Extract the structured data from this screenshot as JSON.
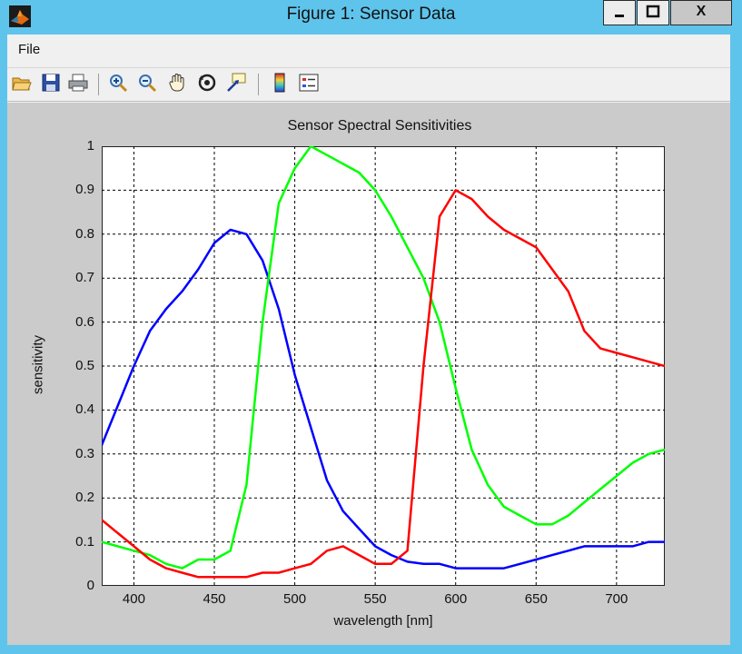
{
  "window": {
    "title": "Figure 1: Sensor Data",
    "close_label": "X"
  },
  "menu": {
    "file": "File"
  },
  "toolbar": {
    "icons": [
      "open-file-icon",
      "save-icon",
      "print-icon",
      "zoom-in-icon",
      "zoom-out-icon",
      "pan-hand-icon",
      "rotate-3d-icon",
      "data-cursor-icon",
      "colorbar-icon",
      "legend-icon"
    ]
  },
  "chart_data": {
    "type": "line",
    "title": "Sensor Spectral Sensitivities",
    "xlabel": "wavelength [nm]",
    "ylabel": "sensitivity",
    "xlim": [
      380,
      730
    ],
    "ylim": [
      0,
      1
    ],
    "grid": true,
    "x_ticks": [
      "400",
      "450",
      "500",
      "550",
      "600",
      "650",
      "700"
    ],
    "y_ticks": [
      "0",
      "0.1",
      "0.2",
      "0.3",
      "0.4",
      "0.5",
      "0.6",
      "0.7",
      "0.8",
      "0.9",
      "1"
    ],
    "series": [
      {
        "color": "#0000ff",
        "x": [
          380,
          390,
          400,
          410,
          420,
          430,
          440,
          450,
          460,
          470,
          480,
          490,
          500,
          510,
          520,
          530,
          540,
          550,
          560,
          570,
          580,
          590,
          600,
          610,
          620,
          630,
          640,
          650,
          660,
          670,
          680,
          690,
          700,
          710,
          720,
          730
        ],
        "y": [
          0.32,
          0.41,
          0.5,
          0.58,
          0.63,
          0.67,
          0.72,
          0.78,
          0.81,
          0.8,
          0.74,
          0.63,
          0.48,
          0.36,
          0.24,
          0.17,
          0.13,
          0.09,
          0.07,
          0.055,
          0.05,
          0.05,
          0.04,
          0.04,
          0.04,
          0.04,
          0.05,
          0.06,
          0.07,
          0.08,
          0.09,
          0.09,
          0.09,
          0.09,
          0.1,
          0.1
        ]
      },
      {
        "color": "#00ff00",
        "x": [
          380,
          390,
          400,
          410,
          420,
          430,
          440,
          450,
          460,
          470,
          480,
          490,
          500,
          510,
          520,
          530,
          540,
          550,
          560,
          570,
          580,
          590,
          600,
          610,
          620,
          630,
          640,
          650,
          660,
          670,
          680,
          690,
          700,
          710,
          720,
          730
        ],
        "y": [
          0.1,
          0.09,
          0.08,
          0.07,
          0.05,
          0.04,
          0.06,
          0.06,
          0.08,
          0.23,
          0.6,
          0.87,
          0.95,
          1.0,
          0.98,
          0.96,
          0.94,
          0.9,
          0.84,
          0.77,
          0.7,
          0.6,
          0.45,
          0.31,
          0.23,
          0.18,
          0.16,
          0.14,
          0.14,
          0.16,
          0.19,
          0.22,
          0.25,
          0.28,
          0.3,
          0.31
        ]
      },
      {
        "color": "#ff0000",
        "x": [
          380,
          390,
          400,
          410,
          420,
          430,
          440,
          450,
          460,
          470,
          480,
          490,
          500,
          510,
          520,
          530,
          540,
          550,
          560,
          570,
          580,
          590,
          600,
          610,
          620,
          630,
          640,
          650,
          660,
          670,
          680,
          690,
          700,
          710,
          720,
          730
        ],
        "y": [
          0.15,
          0.12,
          0.09,
          0.06,
          0.04,
          0.03,
          0.02,
          0.02,
          0.02,
          0.02,
          0.03,
          0.03,
          0.04,
          0.05,
          0.08,
          0.09,
          0.07,
          0.05,
          0.05,
          0.08,
          0.5,
          0.84,
          0.9,
          0.88,
          0.84,
          0.81,
          0.79,
          0.77,
          0.72,
          0.67,
          0.58,
          0.54,
          0.53,
          0.52,
          0.51,
          0.5
        ]
      }
    ]
  }
}
